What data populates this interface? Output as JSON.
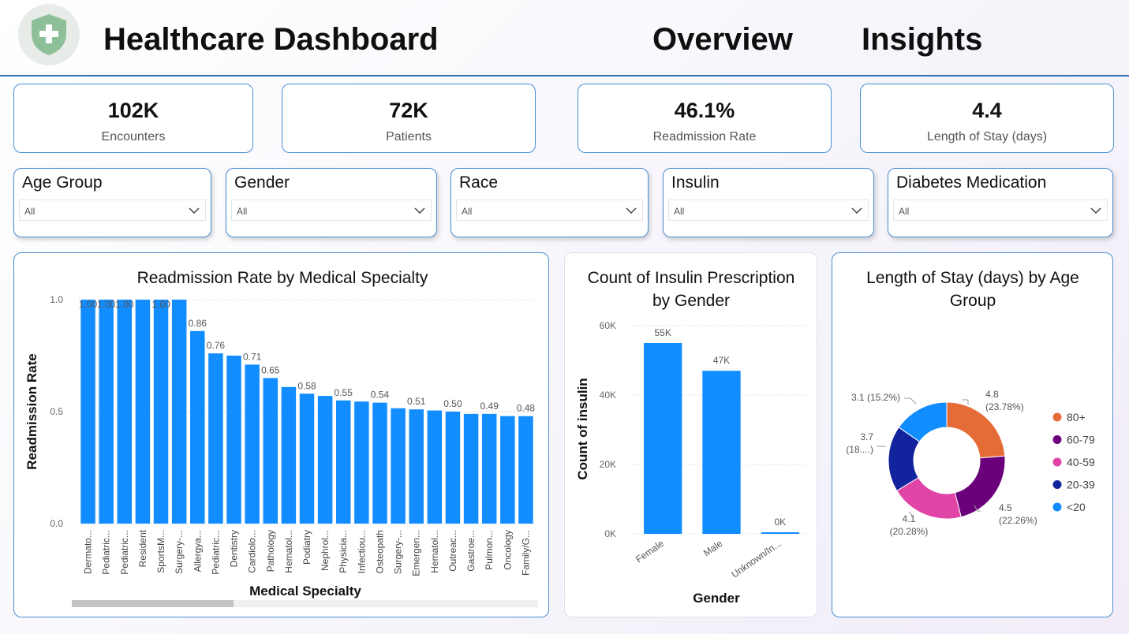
{
  "header": {
    "title": "Healthcare Dashboard",
    "nav": [
      "Overview",
      "Insights"
    ]
  },
  "kpis": [
    {
      "value": "102K",
      "label": "Encounters"
    },
    {
      "value": "72K",
      "label": "Patients"
    },
    {
      "value": "46.1%",
      "label": "Readmission Rate"
    },
    {
      "value": "4.4",
      "label": "Length of Stay (days)"
    }
  ],
  "filters": [
    {
      "title": "Age Group",
      "value": "All"
    },
    {
      "title": "Gender",
      "value": "All"
    },
    {
      "title": "Race",
      "value": "All"
    },
    {
      "title": "Insulin",
      "value": "All"
    },
    {
      "title": "Diabetes Medication",
      "value": "All"
    }
  ],
  "colors": {
    "accent": "#118dff",
    "border": "#4a8fd0",
    "header_line": "#2f6fb2",
    "logo_shield": "#8dbf98"
  },
  "icons": {
    "logo": "shield-plus-icon",
    "dropdown": "chevron-down-icon"
  },
  "chart_data": [
    {
      "type": "bar",
      "title": "Readmission Rate by Medical Specialty",
      "xlabel": "Medical Specialty",
      "ylabel": "Readmission Rate",
      "ylim": [
        0,
        1
      ],
      "yticks": [
        "0.0",
        "0.5",
        "1.0"
      ],
      "grid": true,
      "color": "#118dff",
      "categories": [
        "Dermato...",
        "Pediatric...",
        "Pediatric...",
        "Resident",
        "SportsM...",
        "Surgery-...",
        "Allergya...",
        "Pediatric...",
        "Dentistry",
        "Cardiolo...",
        "Pathology",
        "Hematol...",
        "Podiatry",
        "Nephrol...",
        "Physicia...",
        "Infectiou...",
        "Osteopath",
        "Surgery-...",
        "Emergen...",
        "Hematol...",
        "Outreac...",
        "Gastroe...",
        "Pulmon...",
        "Oncology",
        "Family/G..."
      ],
      "values": [
        1.0,
        1.0,
        1.0,
        1.0,
        1.0,
        1.0,
        0.86,
        0.76,
        0.75,
        0.71,
        0.65,
        0.61,
        0.58,
        0.57,
        0.55,
        0.545,
        0.54,
        0.515,
        0.51,
        0.505,
        0.5,
        0.49,
        0.49,
        0.48,
        0.48
      ],
      "data_labels": [
        "1.00",
        "1.00",
        "1.00",
        "",
        "1.00",
        "",
        "0.86",
        "0.76",
        "",
        "0.71",
        "0.65",
        "",
        "0.58",
        "",
        "0.55",
        "",
        "0.54",
        "",
        "0.51",
        "",
        "0.50",
        "",
        "0.49",
        "",
        "0.48"
      ]
    },
    {
      "type": "bar",
      "title": "Count of Insulin Prescription by Gender",
      "title_lines": [
        "Count of Insulin Prescription",
        "by Gender"
      ],
      "xlabel": "Gender",
      "ylabel": "Count of insulin",
      "ylim": [
        0,
        60000
      ],
      "yticks": [
        "0K",
        "20K",
        "40K",
        "60K"
      ],
      "grid": true,
      "color": "#118dff",
      "categories": [
        "Female",
        "Male",
        "Unknown/In..."
      ],
      "values": [
        55000,
        47000,
        300
      ],
      "data_labels": [
        "55K",
        "47K",
        "0K"
      ]
    },
    {
      "type": "pie",
      "donut": true,
      "title": "Length of Stay (days) by Age Group",
      "title_lines": [
        "Length of Stay (days) by Age",
        "Group"
      ],
      "legend_position": "right",
      "categories": [
        "80+",
        "60-79",
        "40-59",
        "20-39",
        "<20"
      ],
      "values": [
        4.8,
        4.5,
        4.1,
        3.7,
        3.1
      ],
      "percents": [
        "23.78%",
        "22.26%",
        "20.28%",
        "18....",
        "15.2%"
      ],
      "slice_labels": [
        [
          "4.8",
          "(23.78%)"
        ],
        [
          "4.5",
          "(22.26%)"
        ],
        [
          "4.1",
          "(20.28%)"
        ],
        [
          "3.7",
          "(18....)"
        ],
        [
          "3.1 (15.2%)"
        ]
      ],
      "colors": [
        "#e66c37",
        "#6b007b",
        "#e044a7",
        "#12239e",
        "#118dff"
      ]
    }
  ]
}
